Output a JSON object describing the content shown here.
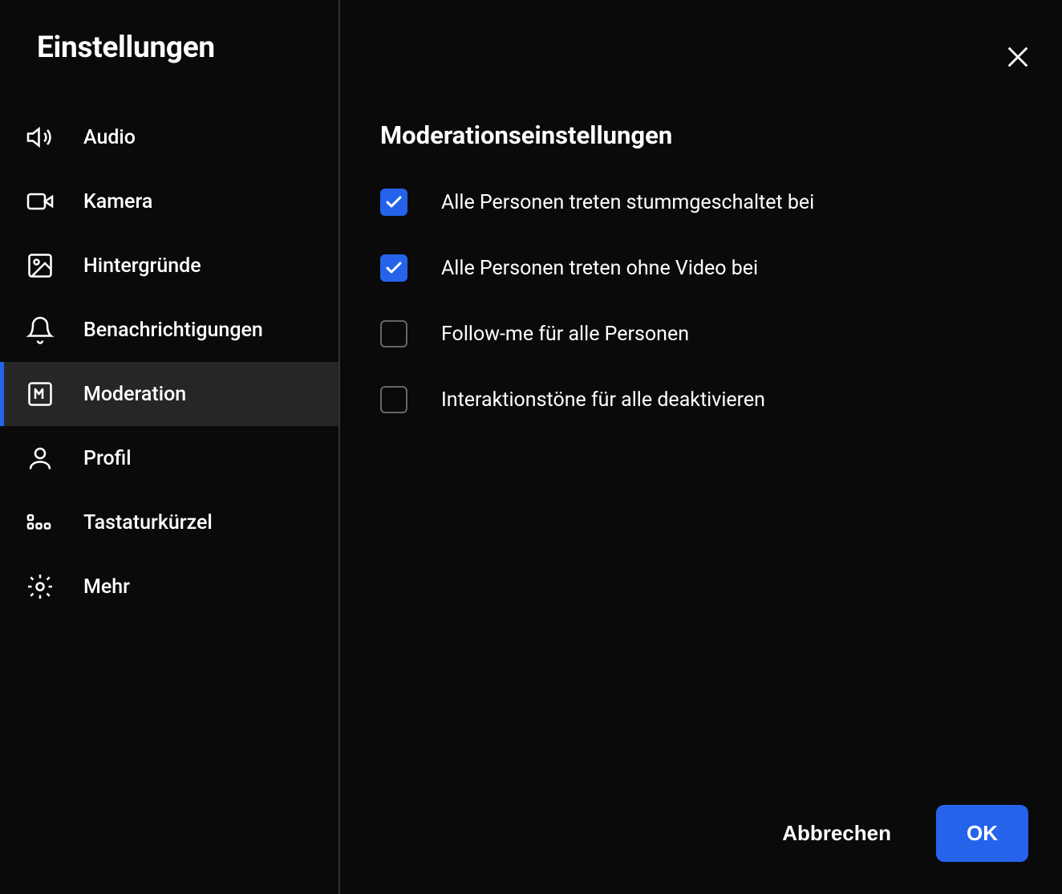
{
  "header": {
    "title": "Einstellungen"
  },
  "sidebar": {
    "items": [
      {
        "label": "Audio"
      },
      {
        "label": "Kamera"
      },
      {
        "label": "Hintergründe"
      },
      {
        "label": "Benachrichtigungen"
      },
      {
        "label": "Moderation"
      },
      {
        "label": "Profil"
      },
      {
        "label": "Tastaturkürzel"
      },
      {
        "label": "Mehr"
      }
    ]
  },
  "main": {
    "section_title": "Moderationseinstellungen",
    "options": [
      {
        "label": "Alle Personen treten stummgeschaltet bei",
        "checked": true
      },
      {
        "label": "Alle Personen treten ohne Video bei",
        "checked": true
      },
      {
        "label": "Follow-me für alle Personen",
        "checked": false
      },
      {
        "label": "Interaktionstöne für alle deaktivieren",
        "checked": false
      }
    ]
  },
  "footer": {
    "cancel": "Abbrechen",
    "ok": "OK"
  }
}
